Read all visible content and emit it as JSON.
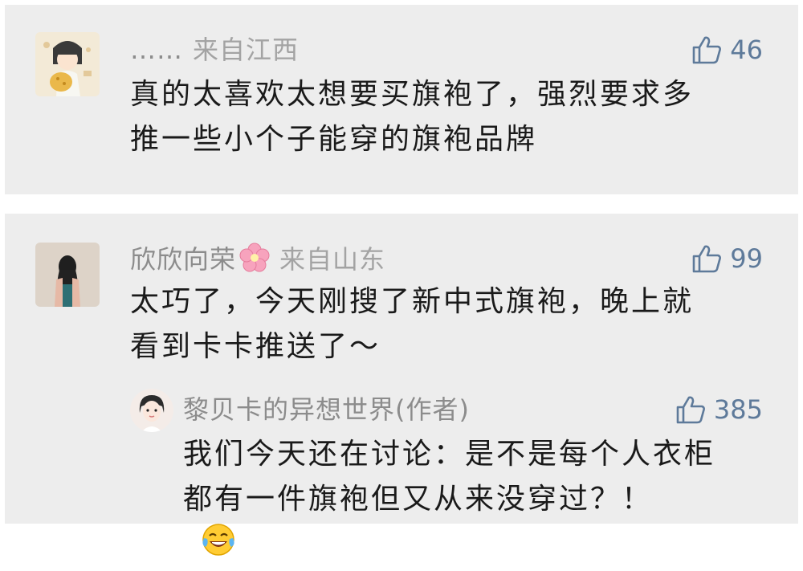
{
  "comments": [
    {
      "user": "……",
      "location": "来自江西",
      "likes": "46",
      "lines": [
        "真的太喜欢太想要买旗袍了，强烈要求多",
        "推一些小个子能穿的旗袍品牌"
      ],
      "avatar_icon": "cartoon-girl-avatar"
    },
    {
      "user": "欣欣向荣",
      "user_emoji": "cherry-blossom-icon",
      "location": "来自山东",
      "likes": "99",
      "lines": [
        "太巧了，今天刚搜了新中式旗袍，晚上就",
        "看到卡卡推送了～"
      ],
      "avatar_icon": "woman-silhouette-avatar",
      "reply": {
        "user": "黎贝卡的异想世界(作者)",
        "likes": "385",
        "lines": [
          "我们今天还在讨论：是不是每个人衣柜",
          "都有一件旗袍但又从来没穿过？！"
        ],
        "trailing_emoji": "tears-of-joy-emoji",
        "avatar_icon": "author-illustration-avatar"
      }
    }
  ],
  "colors": {
    "card_bg": "#ededed",
    "name": "#8c8c8c",
    "like": "#5e7a9a",
    "text": "#1a1a1a"
  }
}
